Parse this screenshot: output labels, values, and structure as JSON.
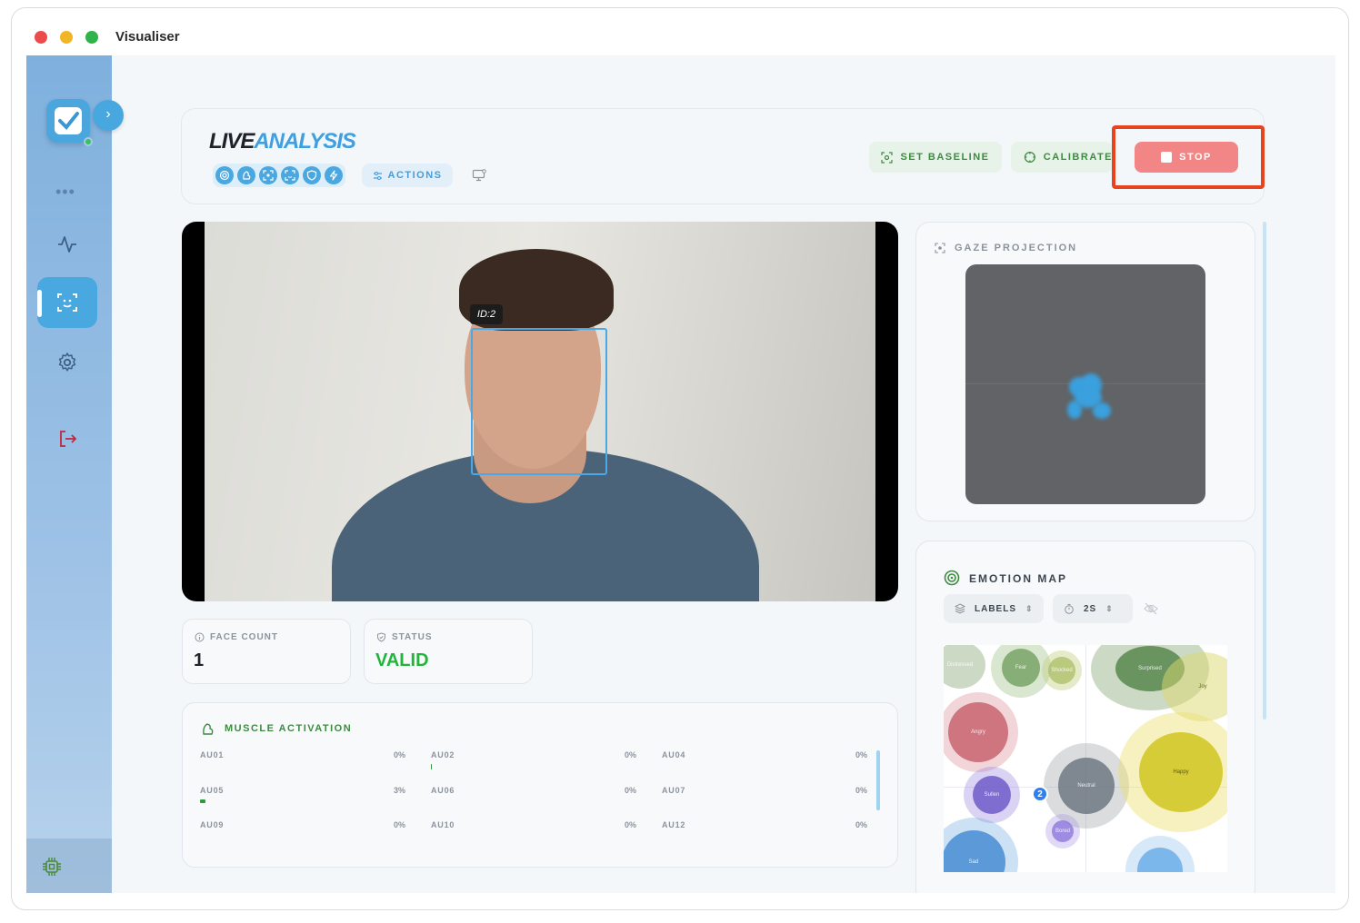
{
  "window": {
    "title": "Visualiser"
  },
  "sidebar": {
    "more": "•••",
    "items": [
      {
        "icon": "activity-icon",
        "active": false
      },
      {
        "icon": "face-scan-icon",
        "active": true
      },
      {
        "icon": "gear-icon",
        "active": false
      },
      {
        "icon": "logout-icon",
        "active": false
      }
    ],
    "footer_icon": "chip-icon"
  },
  "header": {
    "title_part1": "LIVE",
    "title_part2": "ANALYSIS",
    "actions_label": "ACTIONS",
    "set_baseline_label": "SET BASELINE",
    "calibrate_label": "CALIBRATE",
    "stop_label": "STOP"
  },
  "video": {
    "face_id": "ID:2"
  },
  "stats": {
    "face_count_label": "FACE COUNT",
    "face_count_value": "1",
    "status_label": "STATUS",
    "status_value": "VALID"
  },
  "muscle": {
    "title": "MUSCLE ACTIVATION",
    "units": [
      {
        "name": "AU01",
        "value": "0%",
        "level": 0
      },
      {
        "name": "AU02",
        "value": "0%",
        "level": 0.005
      },
      {
        "name": "AU04",
        "value": "0%",
        "level": 0
      },
      {
        "name": "AU05",
        "value": "3%",
        "level": 0.03
      },
      {
        "name": "AU06",
        "value": "0%",
        "level": 0
      },
      {
        "name": "AU07",
        "value": "0%",
        "level": 0
      },
      {
        "name": "AU09",
        "value": "0%",
        "level": 0
      },
      {
        "name": "AU10",
        "value": "0%",
        "level": 0
      },
      {
        "name": "AU12",
        "value": "0%",
        "level": 0
      }
    ]
  },
  "gaze": {
    "title": "GAZE PROJECTION"
  },
  "emotion": {
    "title": "EMOTION MAP",
    "labels_toggle": "LABELS",
    "interval": "2S",
    "marker": "2",
    "emotions": [
      "Distressed",
      "Fear",
      "Shocked",
      "Surprised",
      "Joy",
      "Angry",
      "Neutral",
      "Happy",
      "Sullen",
      "Bored",
      "Sad"
    ]
  },
  "colors": {
    "accent": "#3f9fe0",
    "green": "#3d8b40",
    "stop": "#f28585",
    "valid": "#22b53c",
    "highlight": "#e8431f"
  }
}
